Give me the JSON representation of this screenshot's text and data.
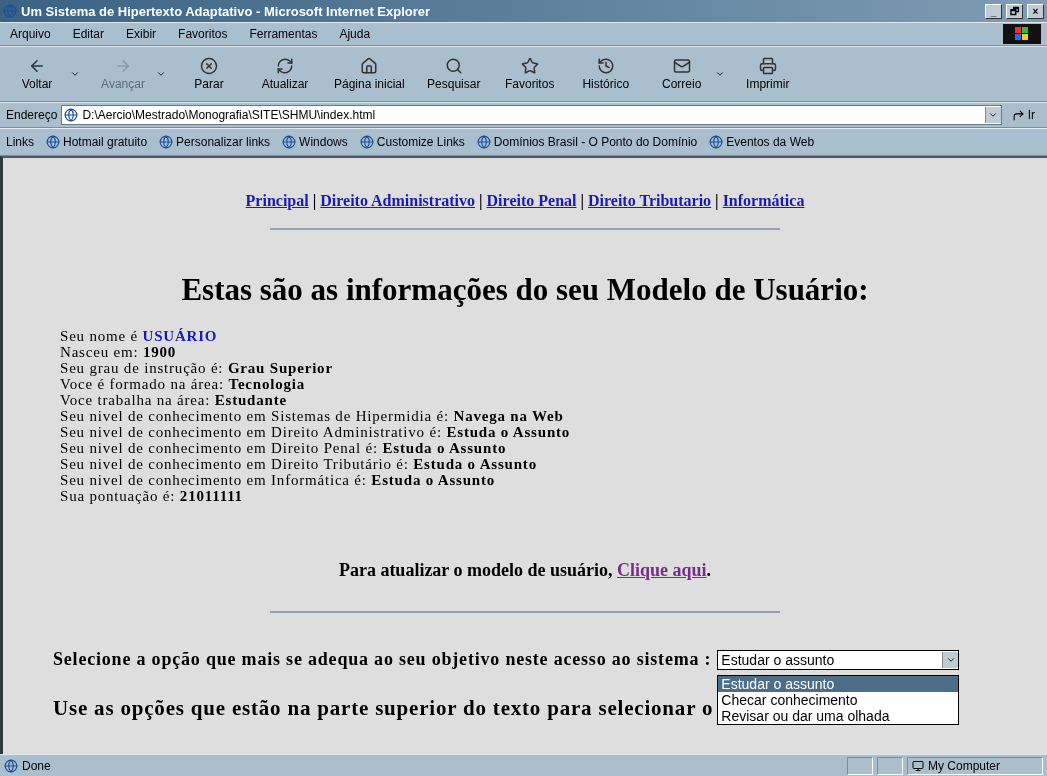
{
  "window": {
    "title": "Um Sistema de Hipertexto Adaptativo - Microsoft Internet Explorer",
    "controls": [
      "_",
      "🗗",
      "×"
    ]
  },
  "menu": [
    "Arquivo",
    "Editar",
    "Exibir",
    "Favoritos",
    "Ferramentas",
    "Ajuda"
  ],
  "toolbar": [
    {
      "kind": "back",
      "label": "Voltar",
      "disabled": false,
      "dropdown": true
    },
    {
      "kind": "forward",
      "label": "Avançar",
      "disabled": true,
      "dropdown": true
    },
    {
      "kind": "stop",
      "label": "Parar",
      "disabled": false,
      "dropdown": false
    },
    {
      "kind": "refresh",
      "label": "Atualizar",
      "disabled": false,
      "dropdown": false
    },
    {
      "kind": "home",
      "label": "Página inicial",
      "disabled": false,
      "dropdown": false
    },
    {
      "kind": "search",
      "label": "Pesquisar",
      "disabled": false,
      "dropdown": false
    },
    {
      "kind": "favorites",
      "label": "Favoritos",
      "disabled": false,
      "dropdown": false
    },
    {
      "kind": "history",
      "label": "Histórico",
      "disabled": false,
      "dropdown": false
    },
    {
      "kind": "mail",
      "label": "Correio",
      "disabled": false,
      "dropdown": true
    },
    {
      "kind": "print",
      "label": "Imprimir",
      "disabled": false,
      "dropdown": false
    }
  ],
  "address": {
    "label": "Endereço",
    "value": "D:\\Aercio\\Mestrado\\Monografia\\SITE\\SHMU\\index.html",
    "go": "Ir"
  },
  "links_bar": {
    "label": "Links",
    "items": [
      "Hotmail gratuito",
      "Personalizar links",
      "Windows",
      "Customize Links",
      "Domínios Brasil - O Ponto do Domínio",
      "Eventos da Web"
    ]
  },
  "page": {
    "nav": [
      "Principal",
      "Direito Administrativo",
      "Direito Penal",
      "Direito Tributario",
      "Informática"
    ],
    "nav_separators": [
      "|",
      "|",
      "|",
      "|"
    ],
    "heading": "Estas são as informações do seu Modelo de Usuário:",
    "profile": [
      {
        "label": "Seu nome é",
        "value": "USUÁRIO",
        "highlighted": true
      },
      {
        "label": "Nasceu em:",
        "value": "1900",
        "highlighted": false
      },
      {
        "label": "Seu grau de instrução é:",
        "value": "Grau Superior",
        "highlighted": false
      },
      {
        "label": "Voce é formado na área:",
        "value": "Tecnologia",
        "highlighted": false
      },
      {
        "label": "Voce trabalha na área:",
        "value": "Estudante",
        "highlighted": false
      },
      {
        "label": "Seu nivel de conhecimento em Sistemas de Hipermidia é:",
        "value": "Navega na Web",
        "highlighted": false
      },
      {
        "label": "Seu nivel de conhecimento em Direito Administrativo é:",
        "value": "Estuda o Assunto",
        "highlighted": false
      },
      {
        "label": "Seu nivel de conhecimento em Direito Penal é:",
        "value": "Estuda o Assunto",
        "highlighted": false
      },
      {
        "label": "Seu nivel de conhecimento em Direito Tributário é:",
        "value": "Estuda o Assunto",
        "highlighted": false
      },
      {
        "label": "Seu nivel de conhecimento em Informática é:",
        "value": "Estuda o Assunto",
        "highlighted": false
      },
      {
        "label": "Sua pontuação é:",
        "value": "21011111",
        "highlighted": false
      }
    ],
    "update_text": "Para atualizar o modelo de usuário,",
    "update_link": "Clique aqui",
    "update_end": ".",
    "select_label": "Selecione a opção que mais se adequa ao seu objetivo neste acesso ao sistema :",
    "select": {
      "value": "Estudar o assunto",
      "expanded": true,
      "options": [
        {
          "label": "Estudar o assunto",
          "selected": true
        },
        {
          "label": "Checar conhecimento",
          "selected": false
        },
        {
          "label": "Revisar ou dar uma olhada",
          "selected": false
        }
      ]
    },
    "instruction": "Use as opções que estão na parte superior do texto para selecionar o"
  },
  "status_bar": {
    "text": "Done",
    "zone": "My Computer"
  }
}
